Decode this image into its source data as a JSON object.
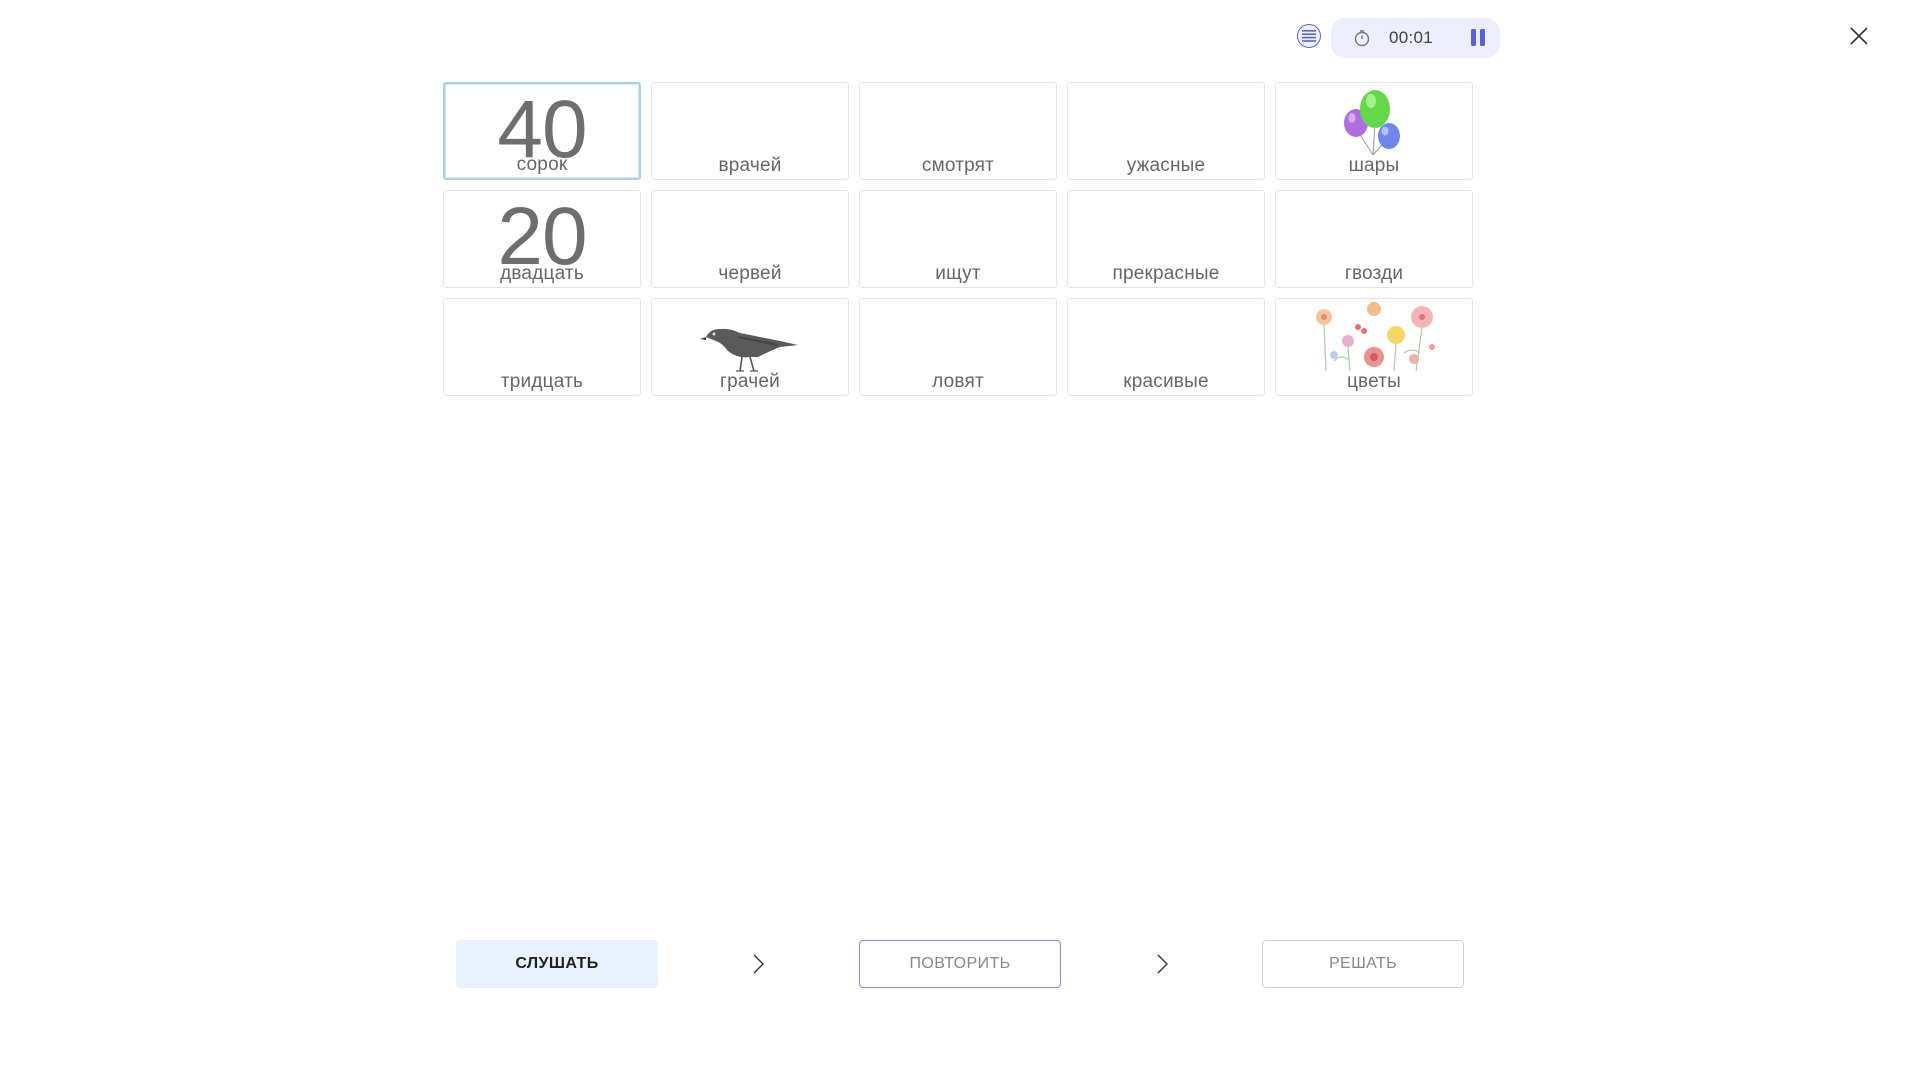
{
  "header": {
    "list_icon": "list-icon",
    "clock_icon": "clock-icon",
    "timer": "00:01",
    "pause_icon": "pause-icon",
    "close_icon": "close-icon",
    "accent_color": "#5a63d6"
  },
  "cards": [
    {
      "word": "сорок",
      "number": "40"
    },
    {
      "word": "врачей"
    },
    {
      "word": "смотрят"
    },
    {
      "word": "ужасные"
    },
    {
      "word": "шары",
      "image": "balloons"
    },
    {
      "word": "двадцать",
      "number": "20"
    },
    {
      "word": "червей"
    },
    {
      "word": "ищут"
    },
    {
      "word": "прекрасные"
    },
    {
      "word": "гвозди"
    },
    {
      "word": "тридцать"
    },
    {
      "word": "грачей",
      "image": "rook-bird"
    },
    {
      "word": "ловят"
    },
    {
      "word": "красивые"
    },
    {
      "word": "цветы",
      "image": "flowers"
    }
  ],
  "footer": {
    "listen_label": "СЛУШАТЬ",
    "repeat_label": "ПОВТОРИТЬ",
    "solve_label": "РЕШАТЬ",
    "chevron_icon": "chevron-right-icon"
  }
}
